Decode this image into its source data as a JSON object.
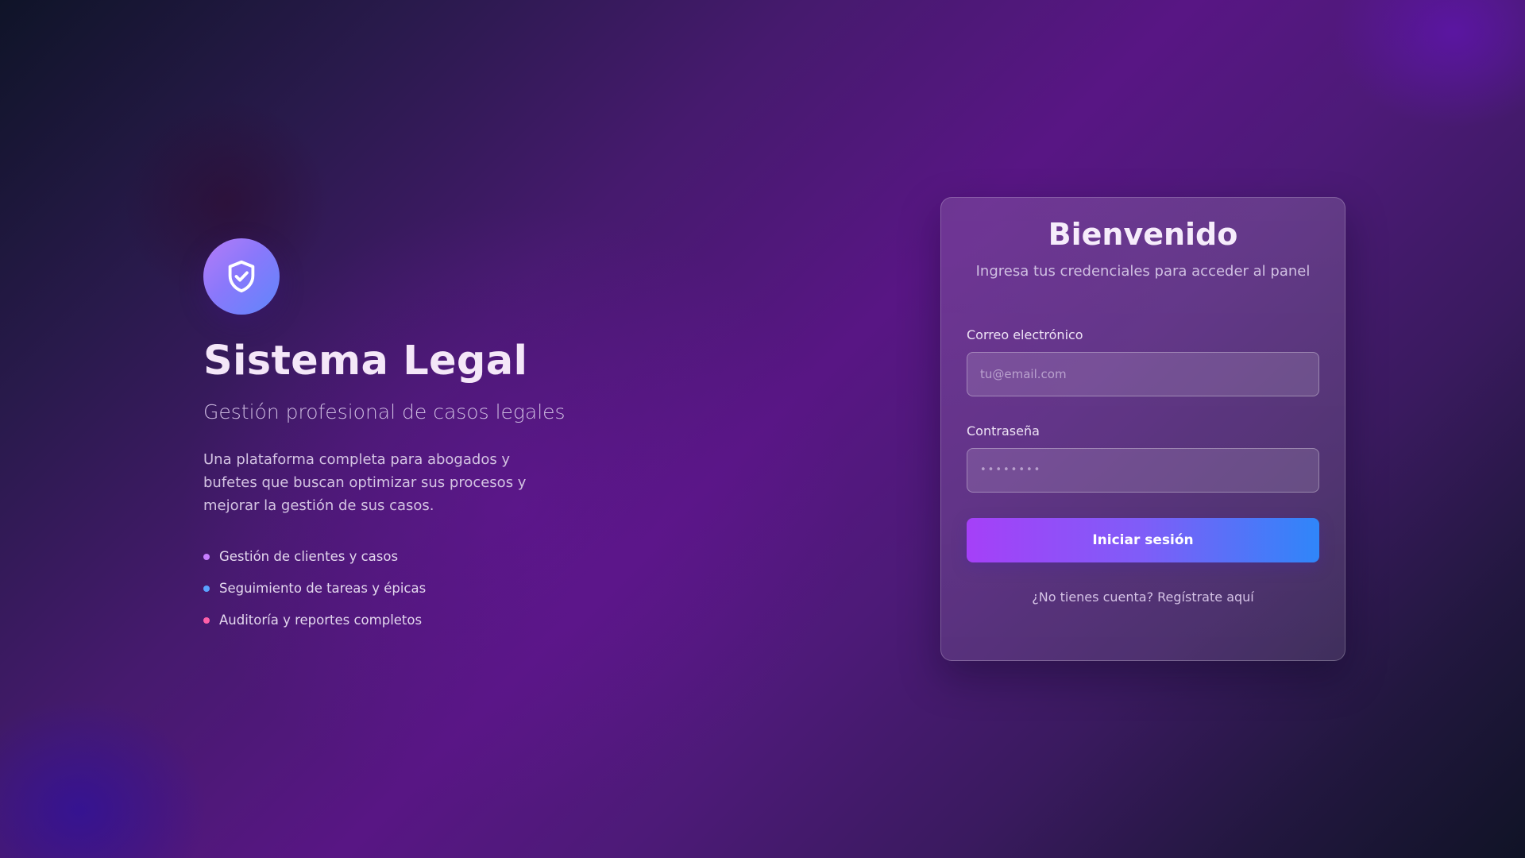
{
  "hero": {
    "logo_icon": "shield-check-icon",
    "title": "Sistema Legal",
    "subtitle": "Gestión profesional de casos legales",
    "description": "Una plataforma completa para abogados y bufetes que buscan optimizar sus procesos y mejorar la gestión de sus casos.",
    "features": [
      {
        "label": "Gestión de clientes y casos",
        "color": "#c77dff"
      },
      {
        "label": "Seguimiento de tareas y épicas",
        "color": "#5aa2ff"
      },
      {
        "label": "Auditoría y reportes completos",
        "color": "#ff5fa8"
      }
    ]
  },
  "login": {
    "title": "Bienvenido",
    "subtitle": "Ingresa tus credenciales para acceder al panel",
    "email": {
      "label": "Correo electrónico",
      "placeholder": "tu@email.com",
      "value": ""
    },
    "password": {
      "label": "Contraseña",
      "placeholder": "••••••••",
      "value": ""
    },
    "submit_label": "Iniciar sesión",
    "register_link": "¿No tienes cuenta? Regístrate aquí"
  },
  "colors": {
    "button_gradient_start": "#a540f8",
    "button_gradient_end": "#2f86f9",
    "logo_gradient_start": "#b57cf7",
    "logo_gradient_end": "#5f86fb"
  }
}
